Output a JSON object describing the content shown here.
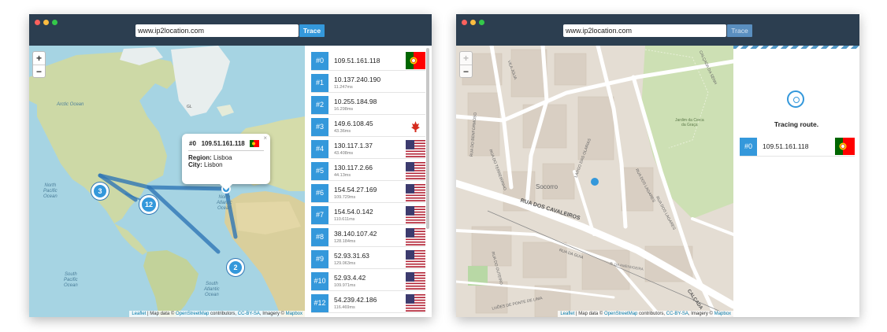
{
  "window1": {
    "url": "www.ip2location.com",
    "trace_label": "Trace",
    "zoom_in": "+",
    "zoom_out": "−",
    "map_labels": {
      "arctic": "Arctic Ocean",
      "atlantic_n": "North\nAtlantic\nOcean",
      "pacific_n": "North\nPacific\nOcean",
      "pacific_s": "South\nPacific\nOcean",
      "atlantic_s": "South\nAtlantic\nOcean",
      "gl": "GL"
    },
    "markers": [
      "3",
      "12",
      "2"
    ],
    "popup": {
      "hop": "#0",
      "ip": "109.51.161.118",
      "region_label": "Region:",
      "region": "Lisboa",
      "city_label": "City:",
      "city": "Lisbon",
      "close": "×"
    },
    "attribution": {
      "leaflet": "Leaflet",
      "text1": " | Map data © ",
      "osm": "OpenStreetMap",
      "text2": " contributors, ",
      "license": "CC-BY-SA",
      "text3": ", Imagery © ",
      "mapbox": "Mapbox"
    },
    "hops": [
      {
        "num": "#0",
        "ip": "109.51.161.118",
        "ms": "",
        "flag": "pt"
      },
      {
        "num": "#1",
        "ip": "10.137.240.190",
        "ms": "11.247ms",
        "flag": "none"
      },
      {
        "num": "#2",
        "ip": "10.255.184.98",
        "ms": "16.298ms",
        "flag": "none"
      },
      {
        "num": "#3",
        "ip": "149.6.108.45",
        "ms": "43.36ms",
        "flag": "ca"
      },
      {
        "num": "#4",
        "ip": "130.117.1.37",
        "ms": "43.408ms",
        "flag": "us"
      },
      {
        "num": "#5",
        "ip": "130.117.2.66",
        "ms": "44.13ms",
        "flag": "us"
      },
      {
        "num": "#6",
        "ip": "154.54.27.169",
        "ms": "109.729ms",
        "flag": "us"
      },
      {
        "num": "#7",
        "ip": "154.54.0.142",
        "ms": "110.611ms",
        "flag": "us"
      },
      {
        "num": "#8",
        "ip": "38.140.107.42",
        "ms": "128.184ms",
        "flag": "us"
      },
      {
        "num": "#9",
        "ip": "52.93.31.63",
        "ms": "129.063ms",
        "flag": "us"
      },
      {
        "num": "#10",
        "ip": "52.93.4.42",
        "ms": "109.971ms",
        "flag": "us"
      },
      {
        "num": "#12",
        "ip": "54.239.42.186",
        "ms": "116.469ms",
        "flag": "us"
      }
    ]
  },
  "window2": {
    "url": "www.ip2location.com",
    "trace_label": "Trace",
    "zoom_in": "+",
    "zoom_out": "−",
    "street_labels": {
      "cavaleiros": "RUA DOS CAVALEIROS",
      "socorro": "Socorro",
      "olarias": "LARGO DAS OLARIAS",
      "lagares1": "RUA DOS LAGARES",
      "lagares2": "RUA DOS LAGARES",
      "guia": "RUA DA GUIA",
      "terreirinho": "RUA DO TERREIRINHO",
      "benformoso": "RUA DO BENFORMOSO",
      "outeiro": "RUA DO OUTEIRO",
      "ponte": "LHÕES DE PONTE DE LIMA",
      "calcada": "CALÇADA",
      "calcada_senhora": "CALÇADA DA SENH",
      "vila": "VILA JÚLIA",
      "jardim": "Jardim da Cerca\nda Graça",
      "amendoeira": "R. DA AMENDOEIRA"
    },
    "tracing_text": "Tracing route.",
    "hop": {
      "num": "#0",
      "ip": "109.51.161.118",
      "flag": "pt"
    },
    "attribution": {
      "leaflet": "Leaflet",
      "text1": " | Map data © ",
      "osm": "OpenStreetMap",
      "text2": " contributors, ",
      "license": "CC-BY-SA",
      "text3": ", Imagery © ",
      "mapbox": "Mapbox"
    }
  },
  "colors": {
    "titlebar": "#2c3e50",
    "accent": "#3498db",
    "ocean": "#a6d4e3",
    "land": "#c9d7a6",
    "route": "#2f76b5",
    "streets": "#e6dfd5"
  }
}
